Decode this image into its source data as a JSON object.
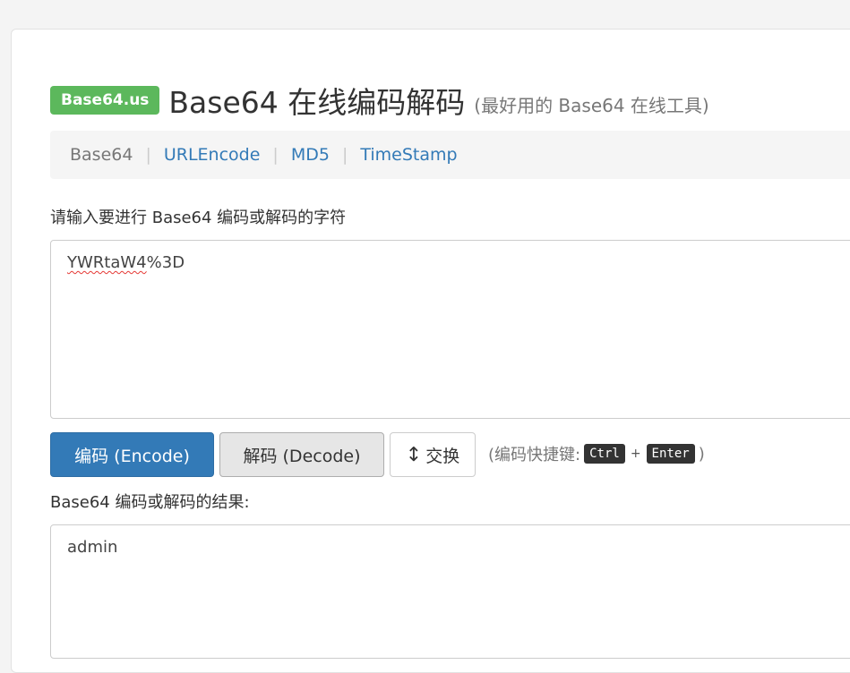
{
  "header": {
    "brand": "Base64.us",
    "title": "Base64 在线编码解码",
    "subtitle": "(最好用的 Base64 在线工具)"
  },
  "nav": {
    "items": [
      {
        "label": "Base64",
        "active": true
      },
      {
        "label": "URLEncode",
        "active": false
      },
      {
        "label": "MD5",
        "active": false
      },
      {
        "label": "TimeStamp",
        "active": false
      }
    ],
    "separator": "|"
  },
  "input": {
    "label": "请输入要进行 Base64 编码或解码的字符",
    "value_misspelled": "YWRtaW4",
    "value_rest": "%3D"
  },
  "buttons": {
    "encode": "编码 (Encode)",
    "decode": "解码 (Decode)",
    "swap_glyph": "↕",
    "swap": "交换"
  },
  "shortcut": {
    "prefix": "(编码快捷键:",
    "key1": "Ctrl",
    "plus": "+",
    "key2": "Enter",
    "suffix": ")"
  },
  "output": {
    "label": "Base64 编码或解码的结果:",
    "value": "admin"
  },
  "colors": {
    "brand_green": "#5cb85c",
    "primary_blue": "#337ab7",
    "link_blue": "#337ab7"
  }
}
